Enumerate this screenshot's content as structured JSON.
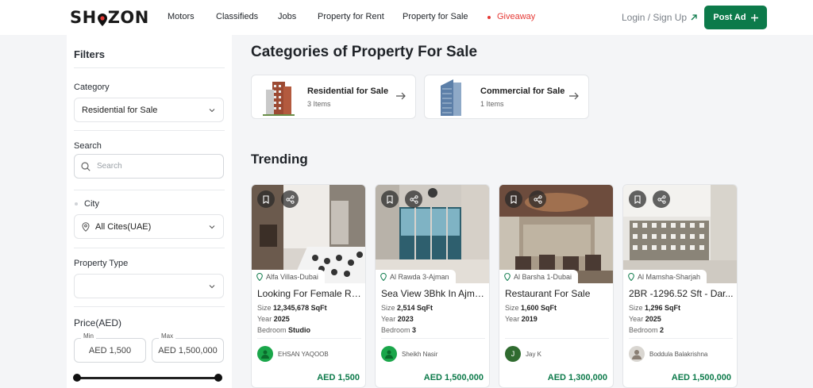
{
  "header": {
    "logo_text": "SHOZON",
    "nav": [
      {
        "label": "Motors"
      },
      {
        "label": "Classifieds"
      },
      {
        "label": "Jobs"
      },
      {
        "label": "Property for Rent"
      },
      {
        "label": "Property for Sale"
      },
      {
        "label": "Giveaway"
      }
    ],
    "login_label": "Login / Sign Up",
    "post_ad_label": "Post Ad",
    "accent_color": "#0c7a4a",
    "giveaway_color": "#e53935"
  },
  "filters": {
    "title": "Filters",
    "category_label": "Category",
    "category_value": "Residential for Sale",
    "search_label": "Search",
    "search_placeholder": "Search",
    "city_label": "City",
    "city_value": "All Cites(UAE)",
    "property_type_label": "Property Type",
    "property_type_value": "",
    "price_label": "Price(AED)",
    "min_caption": "Min",
    "max_caption": "Max",
    "min_value": "AED 1,500",
    "max_value": "AED 1,500,000"
  },
  "categories": {
    "title": "Categories of Property For Sale",
    "items": [
      {
        "name": "Residential for Sale",
        "count": "3 Items",
        "icon": "residential-building-icon"
      },
      {
        "name": "Commercial for Sale",
        "count": "1 Items",
        "icon": "commercial-tower-icon"
      }
    ]
  },
  "trending": {
    "title": "Trending",
    "size_label": "Size",
    "year_label": "Year",
    "bedroom_label": "Bedroom",
    "listings": [
      {
        "location": "Alfa Villas-Dubai",
        "title": "Looking For Female Ro...",
        "size": "12,345,678 SqFt",
        "year": "2025",
        "bedroom": "Studio",
        "seller": "EHSAN YAQOOB",
        "price": "AED 1,500"
      },
      {
        "location": "Al Rawda 3-Ajman",
        "title": "Sea View 3Bhk In Ajma...",
        "size": "2,514 SqFt",
        "year": "2023",
        "bedroom": "3",
        "seller": "Sheikh Nasir",
        "price": "AED 1,500,000"
      },
      {
        "location": "Al Barsha 1-Dubai",
        "title": "Restaurant For Sale",
        "size": "1,600 SqFt",
        "year": "2019",
        "bedroom": "",
        "seller": "Jay K",
        "seller_initial": "J",
        "price": "AED 1,300,000"
      },
      {
        "location": "Al Mamsha-Sharjah",
        "title": "2BR -1296.52 Sft - Dar...",
        "size": "1,296 SqFt",
        "year": "2025",
        "bedroom": "2",
        "seller": "Boddula Balakrishna",
        "price": "AED 1,500,000"
      }
    ]
  }
}
